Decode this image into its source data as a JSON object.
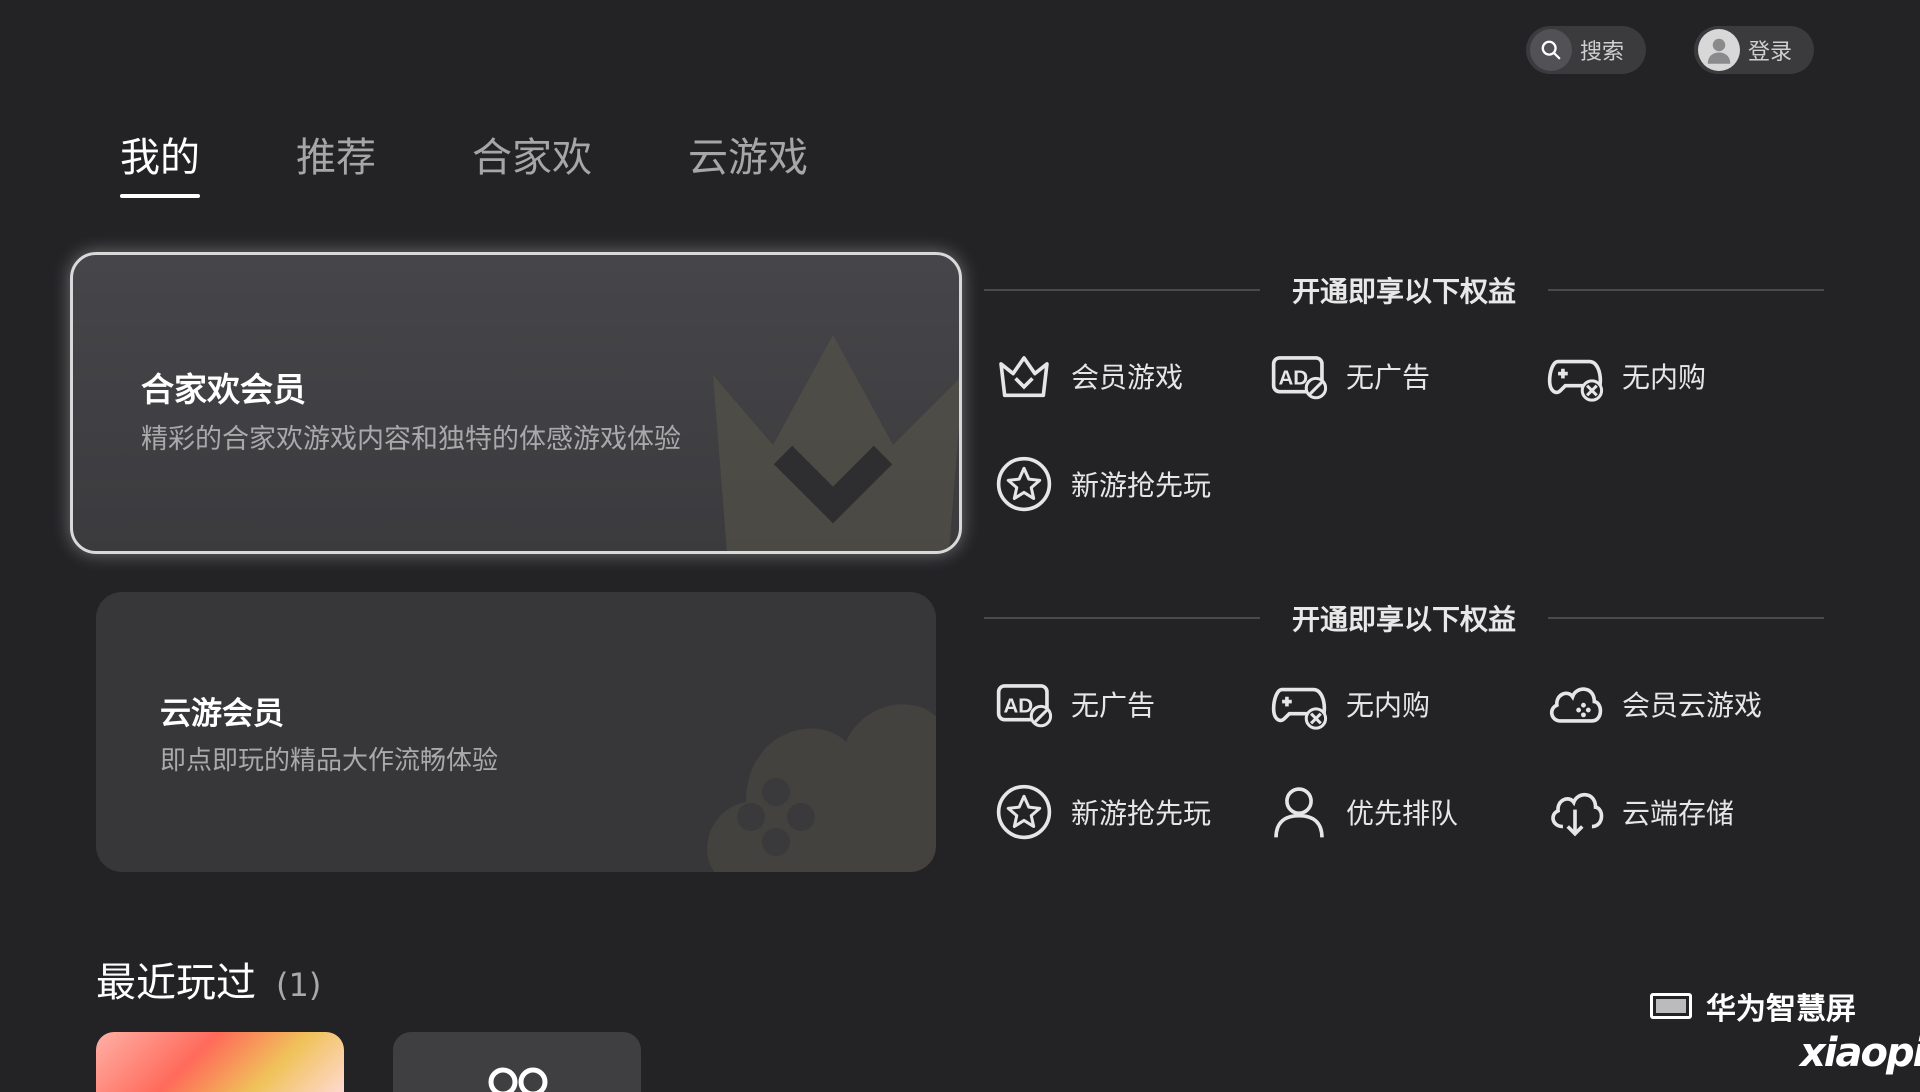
{
  "topbar": {
    "search_label": "搜索",
    "login_label": "登录"
  },
  "tabs": [
    {
      "label": "我的",
      "active": true
    },
    {
      "label": "推荐",
      "active": false
    },
    {
      "label": "合家欢",
      "active": false
    },
    {
      "label": "云游戏",
      "active": false
    }
  ],
  "memberships": [
    {
      "title": "合家欢会员",
      "subtitle": "精彩的合家欢游戏内容和独特的体感游戏体验",
      "benefits_header": "开通即享以下权益",
      "benefits": [
        {
          "label": "会员游戏",
          "icon": "crown-icon"
        },
        {
          "label": "无广告",
          "icon": "no-ad-icon"
        },
        {
          "label": "无内购",
          "icon": "no-purchase-gamepad-icon"
        },
        {
          "label": "新游抢先玩",
          "icon": "star-icon"
        }
      ]
    },
    {
      "title": "云游会员",
      "subtitle": "即点即玩的精品大作流畅体验",
      "benefits_header": "开通即享以下权益",
      "benefits": [
        {
          "label": "无广告",
          "icon": "no-ad-icon"
        },
        {
          "label": "无内购",
          "icon": "no-purchase-gamepad-icon"
        },
        {
          "label": "会员云游戏",
          "icon": "cloud-gamepad-icon"
        },
        {
          "label": "新游抢先玩",
          "icon": "star-icon"
        },
        {
          "label": "优先排队",
          "icon": "user-icon"
        },
        {
          "label": "云端存储",
          "icon": "cloud-download-icon"
        }
      ]
    }
  ],
  "recent": {
    "title": "最近玩过",
    "count": "(1)"
  },
  "brand": {
    "label": "华为智慧屏"
  },
  "watermark": "xiaopi",
  "colors": {
    "background": "#232326",
    "card": "#37373a",
    "focus_border": "#d9d9d9"
  }
}
